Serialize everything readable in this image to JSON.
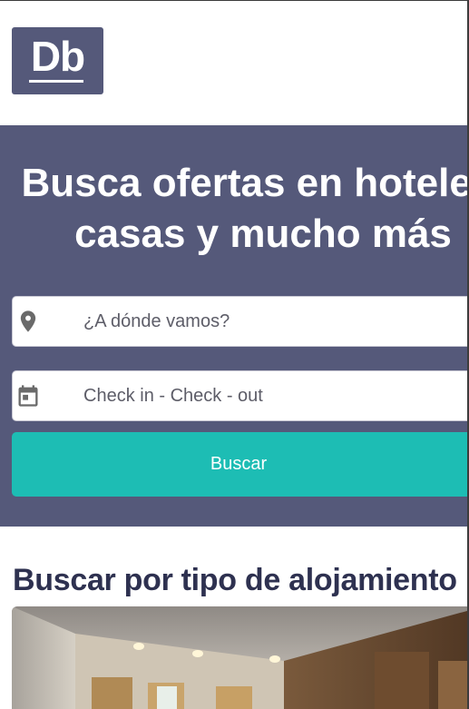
{
  "header": {
    "logo_text": "Db"
  },
  "hero": {
    "title_line1": "Busca ofertas en hoteles,",
    "title_line2": "casas y mucho más",
    "destination": {
      "icon": "location-pin-icon",
      "placeholder": "¿A dónde vamos?"
    },
    "dates": {
      "icon": "calendar-icon",
      "placeholder": "Check in - Check - out"
    },
    "search_button_label": "Buscar"
  },
  "sections": {
    "accommodation_type_title": "Buscar por tipo de alojamiento"
  },
  "colors": {
    "brand_slate": "#55597a",
    "accent_teal": "#1dbdb4",
    "heading_navy": "#2e3150"
  }
}
